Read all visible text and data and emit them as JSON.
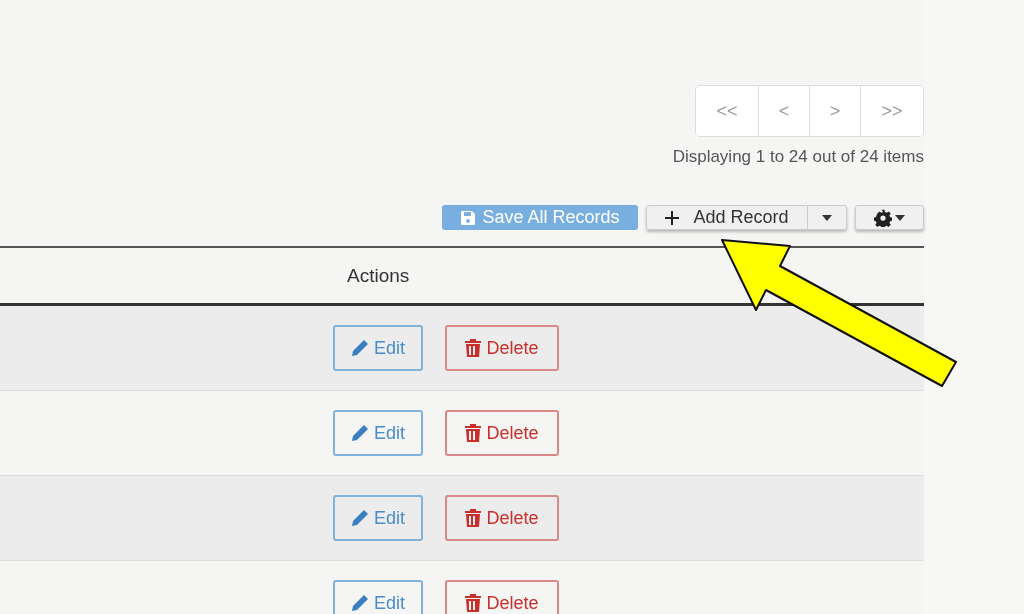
{
  "pager": {
    "buttons": [
      "<<",
      "<",
      ">",
      ">>"
    ],
    "status": "Displaying 1 to 24 out of 24 items"
  },
  "toolbar": {
    "save_label": "Save All Records",
    "add_label": "Add Record"
  },
  "table": {
    "columns": [
      "Actions"
    ],
    "rows": [
      {
        "edit": "Edit",
        "delete": "Delete"
      },
      {
        "edit": "Edit",
        "delete": "Delete"
      },
      {
        "edit": "Edit",
        "delete": "Delete"
      },
      {
        "edit": "Edit",
        "delete": "Delete"
      }
    ]
  }
}
